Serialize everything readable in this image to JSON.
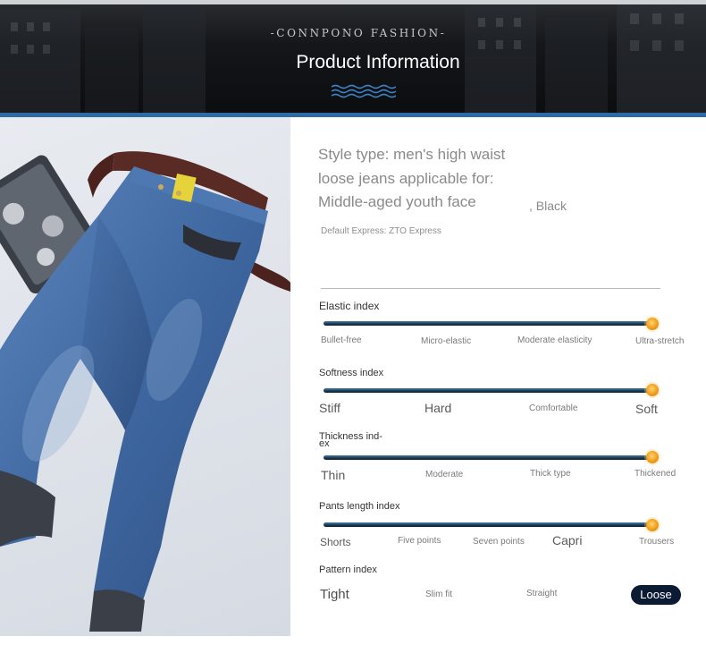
{
  "header": {
    "brand": "-CONNPONO FASHION-",
    "title": "Product Information"
  },
  "info": {
    "style_text": "Style type: men's high waist loose jeans applicable for: Middle-aged youth face",
    "color": ", Black",
    "express": "Default Express: ZTO Express"
  },
  "indices": [
    {
      "label": "Elastic index",
      "level": 1.0,
      "options": [
        "Bullet-free",
        "Micro-elastic",
        "Moderate elasticity",
        "Ultra-stretch"
      ]
    },
    {
      "label": "Softness index",
      "level": 1.0,
      "options": [
        "Stiff",
        "Hard",
        "Comfortable",
        "Soft"
      ]
    },
    {
      "label": "Thickness ind- ex",
      "level": 1.0,
      "options": [
        "Thin",
        "Moderate",
        "Thick type",
        "Thickened"
      ]
    },
    {
      "label": "Pants length index",
      "level": 1.0,
      "options": [
        "Shorts",
        "Five points",
        "Seven points",
        "Capri",
        "Trousers"
      ]
    },
    {
      "label": "Pattern index",
      "options": [
        "Tight",
        "Slim fit",
        "Straight",
        "Loose"
      ],
      "selected": "Loose"
    }
  ],
  "colors": {
    "accent_blue": "#2e6aa3",
    "knob": "#f5a623",
    "selected_pill": "#0c1b34"
  }
}
